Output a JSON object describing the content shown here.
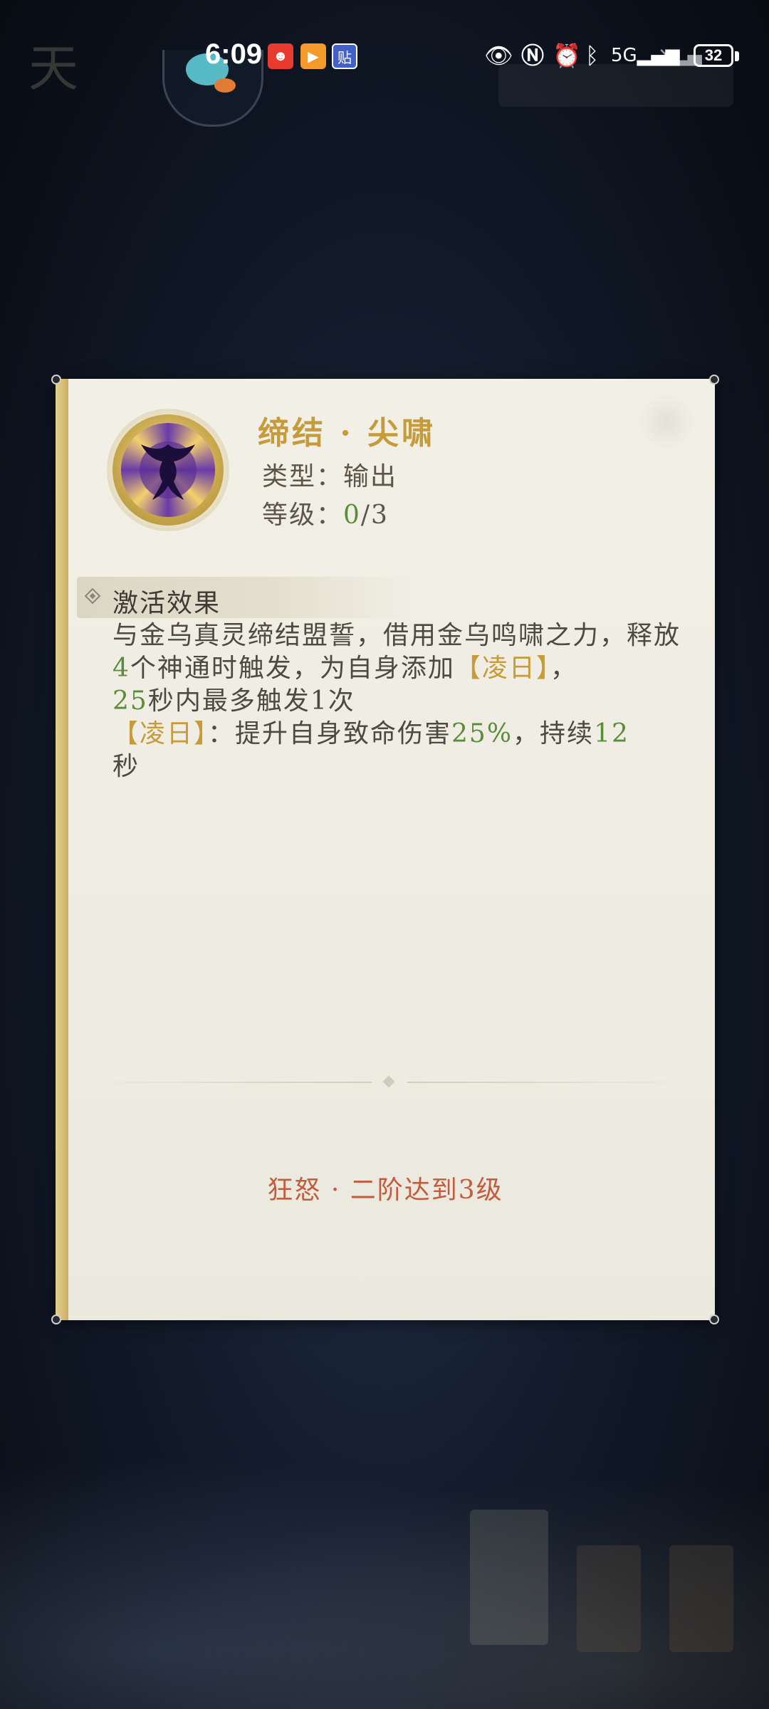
{
  "status_bar": {
    "time": "6:09",
    "notifications": [
      {
        "icon": "red-app-icon",
        "glyph": "☻"
      },
      {
        "icon": "orange-play-icon",
        "glyph": "▶"
      },
      {
        "icon": "tieba-icon",
        "glyph": "贴"
      }
    ],
    "system_icons": [
      "eye-icon",
      "nfc-icon",
      "alarm-icon",
      "bluetooth-icon",
      "signal-5g-icon",
      "signal-no-sim-icon"
    ],
    "battery_level": "32"
  },
  "skill": {
    "name": "缔结 · 尖啸",
    "type_label": "类型：",
    "type_value": "输出",
    "level_label": "等级：",
    "level_current": "0",
    "level_max": "/3"
  },
  "effect_section": {
    "title": "激活效果",
    "description": [
      {
        "text": "与金乌真灵缔结盟誓，借用金乌鸣啸之力，",
        "style": "normal"
      },
      {
        "text": "释放",
        "style": "normal"
      },
      {
        "text": "4",
        "style": "green"
      },
      {
        "text": "个神通时触发，为自身添加",
        "style": "normal"
      },
      {
        "text": "【凌日】",
        "style": "gold"
      },
      {
        "text": "，",
        "style": "normal"
      },
      {
        "text": "25",
        "style": "green"
      },
      {
        "text": "秒内最多触发1次",
        "style": "normal"
      },
      {
        "text": "【凌日】",
        "style": "gold"
      },
      {
        "text": "：提升自身致命伤害",
        "style": "normal"
      },
      {
        "text": "25%",
        "style": "green"
      },
      {
        "text": "，持续",
        "style": "normal"
      },
      {
        "text": "12",
        "style": "green"
      },
      {
        "text": "秒",
        "style": "normal"
      }
    ]
  },
  "requirement": "狂怒 · 二阶达到3级",
  "colors": {
    "title_gold": "#c69b3a",
    "value_green": "#5a8d3a",
    "requirement_red": "#c35c3d",
    "panel_bg": "#f2f0e6"
  }
}
